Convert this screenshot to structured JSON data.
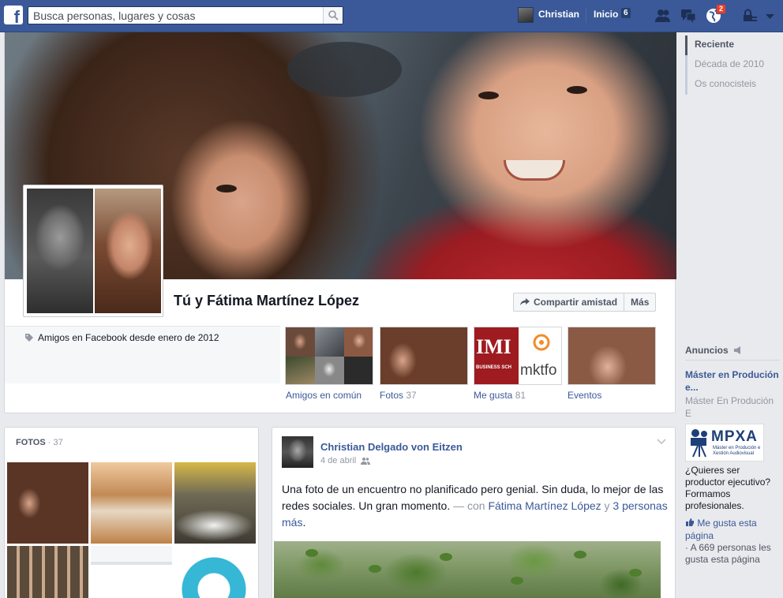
{
  "topbar": {
    "logo": "f",
    "search_placeholder": "Busca personas, lugares y cosas",
    "user_name": "Christian",
    "home_label": "Inicio",
    "home_count": "6",
    "notifications_count": "2"
  },
  "timeline_nav": {
    "items": [
      {
        "label": "Reciente",
        "active": true
      },
      {
        "label": "Década de 2010",
        "active": false
      },
      {
        "label": "Os conocisteis",
        "active": false
      }
    ]
  },
  "friendship": {
    "title": "Tú y Fátima Martínez López",
    "share_button": "Compartir amistad",
    "more_button": "Más",
    "friends_since": "Amigos en Facebook desde enero de 2012",
    "tiles": [
      {
        "label": "Amigos en común",
        "count": ""
      },
      {
        "label": "Fotos",
        "count": "37"
      },
      {
        "label": "Me gusta",
        "count": "81"
      },
      {
        "label": "Eventos",
        "count": ""
      }
    ],
    "likes_tile_text": {
      "left": "IMI",
      "left_sub": "BUSINESS SCH",
      "right": "mktfo"
    }
  },
  "photos": {
    "title": "FOTOS",
    "count": "· 37"
  },
  "post": {
    "author": "Christian Delgado von Eitzen",
    "date": "4 de abril",
    "text": "Una foto de un encuentro no planificado pero genial. Sin duda, lo mejor de las redes sociales. Un gran momento.",
    "with_label": "— con",
    "tagged_person": "Fátima Martínez López",
    "and_label": "y",
    "others": "3 personas más",
    "end": "."
  },
  "ads": {
    "title": "Anuncios",
    "ad_title": "Máster en Produción e...",
    "ad_subtitle": "Máster En Produción E",
    "ad_logo": "MPXA",
    "ad_logo_sub": "Máster en Produción e Xestión Audiovisual",
    "ad_body": "¿Quieres ser productor ejecutivo? Formamos profesionales.",
    "ad_like": "Me gusta esta página",
    "ad_like_count": "· A 669 personas les gusta esta página"
  },
  "colors": {
    "brand": "#3b5998",
    "background": "#e9eaed",
    "badge": "#f03d25"
  }
}
